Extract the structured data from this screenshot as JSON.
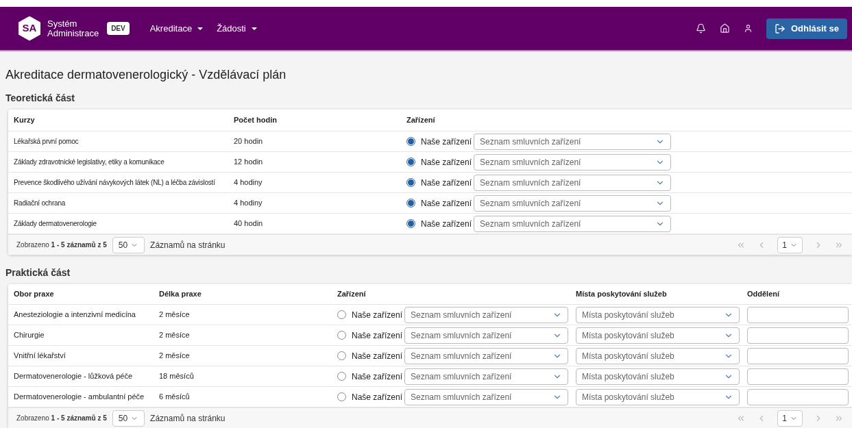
{
  "header": {
    "logo": "SA",
    "app_name_line1": "Systém",
    "app_name_line2": "Administrace",
    "env_badge": "DEV",
    "menu": [
      {
        "label": "Akreditace"
      },
      {
        "label": "Žádosti"
      }
    ],
    "logout": "Odhlásit se"
  },
  "title": "Akreditace dermatovenerologický - Vzdělávací plán",
  "theory": {
    "heading": "Teoretická část",
    "columns": [
      "Kurzy",
      "Počet hodin",
      "Zařízení"
    ],
    "rows": [
      {
        "course": "Lékařská první pomoc",
        "hours": "20 hodin",
        "own_label": "Naše zařízení",
        "own_selected": true,
        "contract_placeholder": "Seznam smluvních zařízení"
      },
      {
        "course": "Základy zdravotnické legislativy, etiky a komunikace",
        "hours": "12 hodin",
        "own_label": "Naše zařízení",
        "own_selected": true,
        "contract_placeholder": "Seznam smluvních zařízení"
      },
      {
        "course": "Prevence škodlivého užívání návykových látek (NL) a léčba závislostí",
        "hours": "4 hodiny",
        "own_label": "Naše zařízení",
        "own_selected": true,
        "contract_placeholder": "Seznam smluvních zařízení"
      },
      {
        "course": "Radiační ochrana",
        "hours": "4 hodiny",
        "own_label": "Naše zařízení",
        "own_selected": true,
        "contract_placeholder": "Seznam smluvních zařízení"
      },
      {
        "course": "Základy dermatovenerologie",
        "hours": "40 hodin",
        "own_label": "Naše zařízení",
        "own_selected": true,
        "contract_placeholder": "Seznam smluvních zařízení"
      }
    ],
    "footer": {
      "summary": "Zobrazeno **1 - 5 záznamů z 5**",
      "page_size": "50",
      "page_size_label": "Záznamů na stránku",
      "page": "1"
    }
  },
  "practice": {
    "heading": "Praktická část",
    "columns": [
      "Obor praxe",
      "Délka praxe",
      "Zařízení",
      "Místa poskytování služeb",
      "Oddělení"
    ],
    "rows": [
      {
        "field": "Anesteziologie a intenzivní medicína",
        "length": "2 měsíce",
        "own_label": "Naše zařízení",
        "own_selected": false,
        "contract_placeholder": "Seznam smluvních zařízení",
        "place_placeholder": "Místa poskytování služeb"
      },
      {
        "field": "Chirurgie",
        "length": "2 měsíce",
        "own_label": "Naše zařízení",
        "own_selected": false,
        "contract_placeholder": "Seznam smluvních zařízení",
        "place_placeholder": "Místa poskytování služeb"
      },
      {
        "field": "Vnitřní lékařství",
        "length": "2 měsíce",
        "own_label": "Naše zařízení",
        "own_selected": false,
        "contract_placeholder": "Seznam smluvních zařízení",
        "place_placeholder": "Místa poskytování služeb"
      },
      {
        "field": "Dermatovenerologie - lůžková péče",
        "length": "18 měsíců",
        "own_label": "Naše zařízení",
        "own_selected": false,
        "contract_placeholder": "Seznam smluvních zařízení",
        "place_placeholder": "Místa poskytování služeb"
      },
      {
        "field": "Dermatovenerologie - ambulantní péče",
        "length": "6 měsíců",
        "own_label": "Naše zařízení",
        "own_selected": false,
        "contract_placeholder": "Seznam smluvních zařízení",
        "place_placeholder": "Místa poskytování služeb"
      }
    ],
    "footer": {
      "summary": "Zobrazeno **1 - 5 záznamů z 5**",
      "page_size": "50",
      "page_size_label": "Záznamů na stránku",
      "page": "1"
    }
  }
}
